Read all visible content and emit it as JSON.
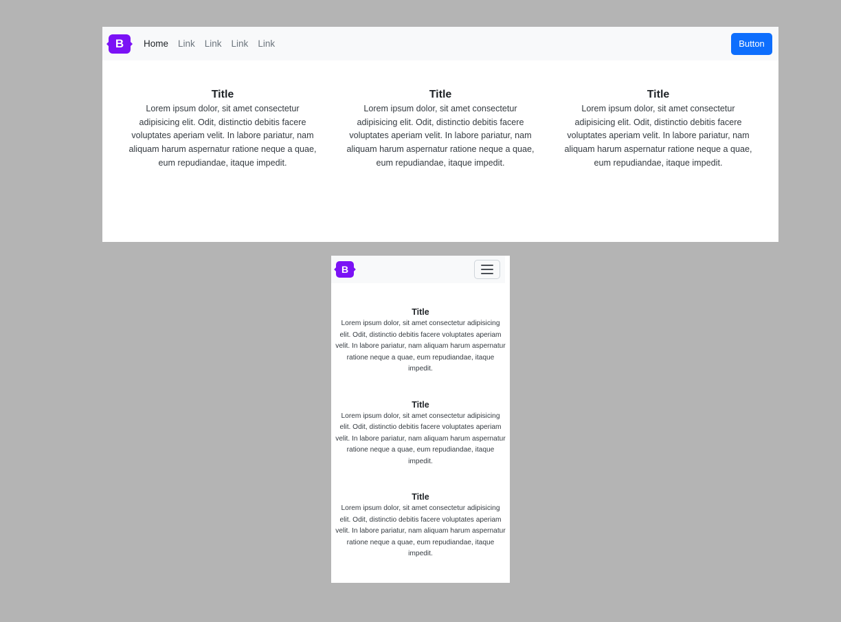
{
  "brand": {
    "letter": "B",
    "color": "#7b12f5"
  },
  "nav": {
    "links": [
      "Home",
      "Link",
      "Link",
      "Link",
      "Link"
    ],
    "button_label": "Button",
    "button_color": "#0d6efd"
  },
  "columns": [
    {
      "title": "Title",
      "body": "Lorem ipsum dolor, sit amet consectetur adipisicing elit. Odit, distinctio debitis facere voluptates aperiam velit. In labore pariatur, nam aliquam harum aspernatur ratione neque a quae, eum repudiandae, itaque impedit."
    },
    {
      "title": "Title",
      "body": "Lorem ipsum dolor, sit amet consectetur adipisicing elit. Odit, distinctio debitis facere voluptates aperiam velit. In labore pariatur, nam aliquam harum aspernatur ratione neque a quae, eum repudiandae, itaque impedit."
    },
    {
      "title": "Title",
      "body": "Lorem ipsum dolor, sit amet consectetur adipisicing elit. Odit, distinctio debitis facere voluptates aperiam velit. In labore pariatur, nam aliquam harum aspernatur ratione neque a quae, eum repudiandae, itaque impedit."
    }
  ],
  "mobile": {
    "toggler_icon": "hamburger-icon"
  }
}
